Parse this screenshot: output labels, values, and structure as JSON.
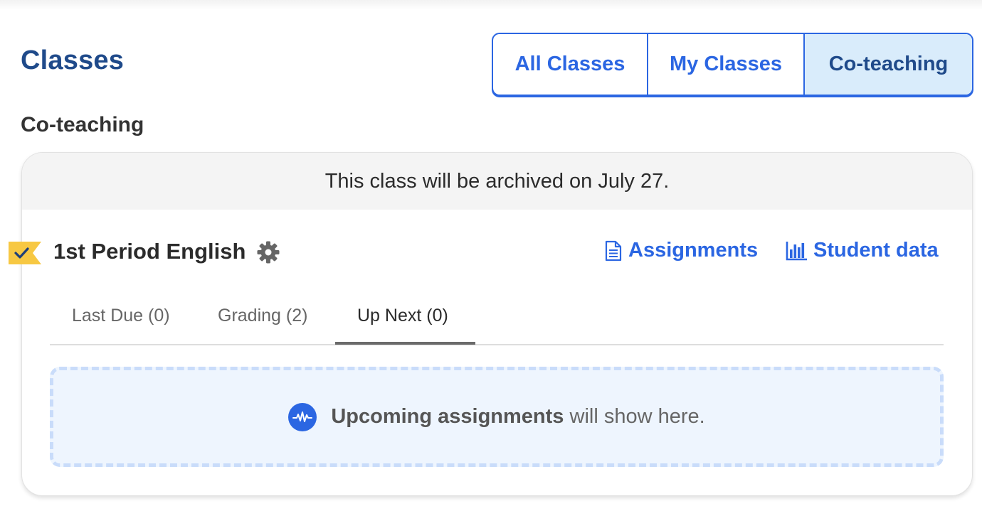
{
  "header": {
    "title": "Classes"
  },
  "filter": {
    "options": [
      "All Classes",
      "My Classes",
      "Co-teaching"
    ],
    "selected": "Co-teaching"
  },
  "section": {
    "title": "Co-teaching"
  },
  "class_card": {
    "archive_notice": "This class will be archived on July 27.",
    "name": "1st Period English",
    "flag_color": "#f7c843",
    "links": {
      "assignments": "Assignments",
      "student_data": "Student data"
    },
    "tabs": [
      {
        "label": "Last Due (0)"
      },
      {
        "label": "Grading (2)"
      },
      {
        "label": "Up Next (0)"
      }
    ],
    "active_tab": "Up Next (0)",
    "empty_state": {
      "bold": "Upcoming assignments",
      "rest": " will show here.",
      "icon": "pulse-icon"
    }
  },
  "colors": {
    "accent": "#2b66e2",
    "title": "#1f4a8a",
    "selected_bg": "#d9ecfb",
    "flag": "#f7c843"
  }
}
